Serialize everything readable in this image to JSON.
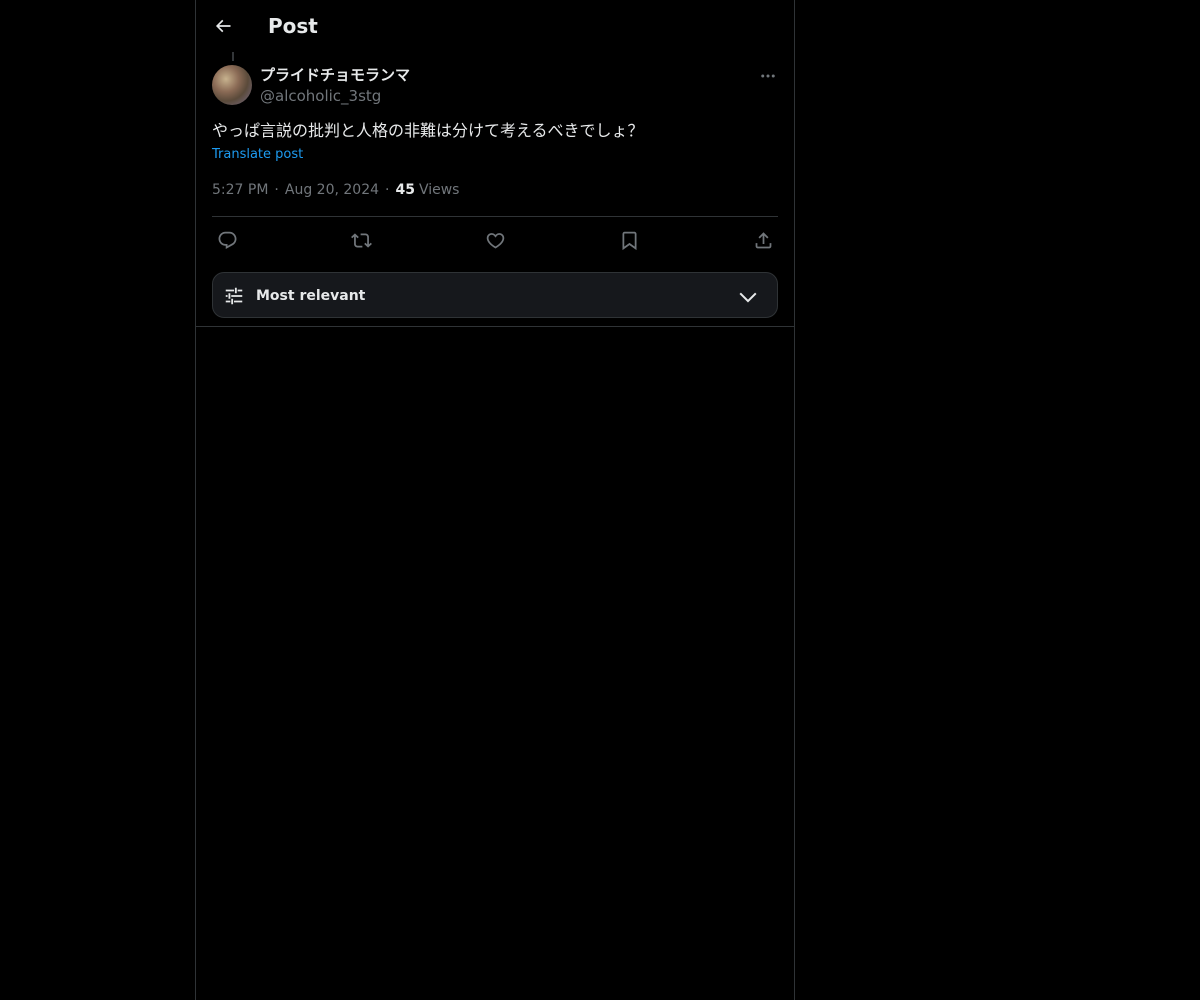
{
  "header": {
    "title": "Post",
    "back_icon": "arrow-left-icon"
  },
  "post": {
    "author_name": "プライドチョモランマ",
    "author_handle": "@alcoholic_3stg",
    "text": "やっぱ言説の批判と人格の非難は分けて考えるべきでしょ？",
    "translate_label": "Translate post",
    "time": "5:27 PM",
    "date": "Aug 20, 2024",
    "separator": "·",
    "views_count": "45",
    "views_label": "Views"
  },
  "actions": [
    {
      "icon": "reply-icon"
    },
    {
      "icon": "repost-icon"
    },
    {
      "icon": "like-icon"
    },
    {
      "icon": "bookmark-icon"
    },
    {
      "icon": "share-icon"
    }
  ],
  "replies_sort": {
    "label": "Most relevant",
    "icon": "sliders-icon",
    "chevron": "chevron-down-icon"
  },
  "colors": {
    "background": "#000000",
    "text": "#e7e9ea",
    "muted": "#71767b",
    "link": "#1d9bf0",
    "border": "#2f3336"
  }
}
